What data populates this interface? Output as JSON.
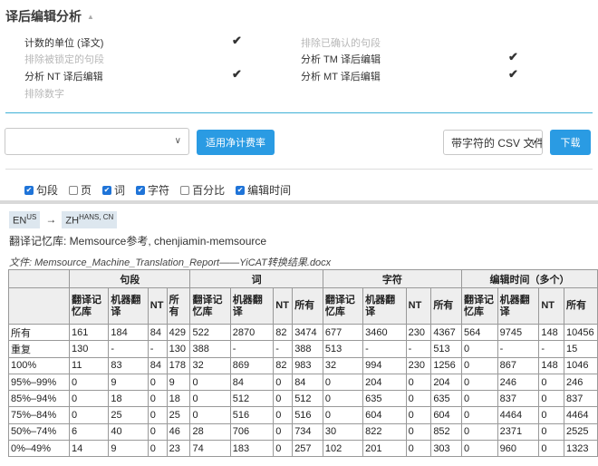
{
  "section": {
    "title": "译后编辑分析"
  },
  "options": {
    "left": [
      {
        "label": "计数的单位 (译文)",
        "disabled": false,
        "checked": true
      },
      {
        "label": "排除被锁定的句段",
        "disabled": true,
        "checked": false
      },
      {
        "label": "分析 NT 译后编辑",
        "disabled": false,
        "checked": true
      },
      {
        "label": "排除数字",
        "disabled": true,
        "checked": false
      }
    ],
    "right": [
      {
        "label": "排除已确认的句段",
        "disabled": true,
        "checked": false
      },
      {
        "label": "分析 TM 译后编辑",
        "disabled": false,
        "checked": true
      },
      {
        "label": "分析 MT 译后编辑",
        "disabled": false,
        "checked": true
      }
    ]
  },
  "toolbar": {
    "rate_select_value": "",
    "apply_label": "适用净计费率",
    "format_value": "带字符的 CSV 文件",
    "download_label": "下载"
  },
  "filters": [
    {
      "label": "句段",
      "checked": true
    },
    {
      "label": "页",
      "checked": false
    },
    {
      "label": "词",
      "checked": true
    },
    {
      "label": "字符",
      "checked": true
    },
    {
      "label": "百分比",
      "checked": false
    },
    {
      "label": "编辑时间",
      "checked": true
    }
  ],
  "report": {
    "source_lang": "EN",
    "source_lang_sup": "US",
    "target_lang": "ZH",
    "target_lang_sup": "HANS, CN",
    "memory_line": "翻译记忆库: Memsource参考, chenjiamin-memsource",
    "file_line": "文件: Memsource_Machine_Translation_Report——YiCAT转换结果.docx"
  },
  "table": {
    "groups": [
      "句段",
      "词",
      "字符",
      "编辑时间（多个）"
    ],
    "subheaders": [
      "翻译记忆库",
      "机器翻译",
      "NT",
      "所有"
    ],
    "rows": [
      {
        "label": "所有",
        "values": [
          "161",
          "184",
          "84",
          "429",
          "522",
          "2870",
          "82",
          "3474",
          "677",
          "3460",
          "230",
          "4367",
          "564",
          "9745",
          "148",
          "10456"
        ]
      },
      {
        "label": "重复",
        "values": [
          "130",
          "-",
          "-",
          "130",
          "388",
          "-",
          "-",
          "388",
          "513",
          "-",
          "-",
          "513",
          "0",
          "-",
          "-",
          "15"
        ]
      },
      {
        "label": "100%",
        "values": [
          "11",
          "83",
          "84",
          "178",
          "32",
          "869",
          "82",
          "983",
          "32",
          "994",
          "230",
          "1256",
          "0",
          "867",
          "148",
          "1046"
        ]
      },
      {
        "label": "95%–99%",
        "values": [
          "0",
          "9",
          "0",
          "9",
          "0",
          "84",
          "0",
          "84",
          "0",
          "204",
          "0",
          "204",
          "0",
          "246",
          "0",
          "246"
        ]
      },
      {
        "label": "85%–94%",
        "values": [
          "0",
          "18",
          "0",
          "18",
          "0",
          "512",
          "0",
          "512",
          "0",
          "635",
          "0",
          "635",
          "0",
          "837",
          "0",
          "837"
        ]
      },
      {
        "label": "75%–84%",
        "values": [
          "0",
          "25",
          "0",
          "25",
          "0",
          "516",
          "0",
          "516",
          "0",
          "604",
          "0",
          "604",
          "0",
          "4464",
          "0",
          "4464"
        ]
      },
      {
        "label": "50%–74%",
        "values": [
          "6",
          "40",
          "0",
          "46",
          "28",
          "706",
          "0",
          "734",
          "30",
          "822",
          "0",
          "852",
          "0",
          "2371",
          "0",
          "2525"
        ]
      },
      {
        "label": "0%–49%",
        "values": [
          "14",
          "9",
          "0",
          "23",
          "74",
          "183",
          "0",
          "257",
          "102",
          "201",
          "0",
          "303",
          "0",
          "960",
          "0",
          "1323"
        ]
      }
    ]
  }
}
